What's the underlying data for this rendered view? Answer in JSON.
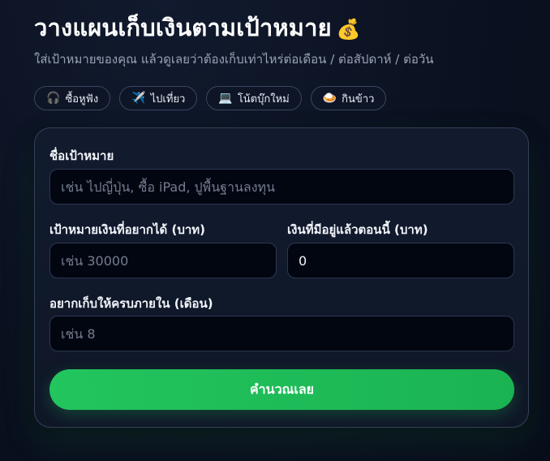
{
  "header": {
    "title": "วางแผนเก็บเงินตามเป้าหมาย",
    "title_emoji": "💰",
    "subtitle": "ใส่เป้าหมายของคุณ แล้วดูเลยว่าต้องเก็บเท่าไหร่ต่อเดือน / ต่อสัปดาห์ / ต่อวัน"
  },
  "presets": [
    {
      "label": "ซื้อหูฟัง",
      "icon": "🎧",
      "icon_name": "headphones-icon"
    },
    {
      "label": "ไปเที่ยว",
      "icon": "✈️",
      "icon_name": "airplane-icon"
    },
    {
      "label": "โน้ตบุ๊กใหม่",
      "icon": "💻",
      "icon_name": "laptop-icon"
    },
    {
      "label": "กินข้าว",
      "icon": "🍛",
      "icon_name": "rice-bowl-icon"
    }
  ],
  "form": {
    "goal_name": {
      "label": "ชื่อเป้าหมาย",
      "placeholder": "เช่น ไปญี่ปุ่น, ซื้อ iPad, ปูพื้นฐานลงทุน",
      "value": ""
    },
    "target_amount": {
      "label": "เป้าหมายเงินที่อยากได้ (บาท)",
      "placeholder": "เช่น 30000",
      "value": ""
    },
    "current_amount": {
      "label": "เงินที่มีอยู่แล้วตอนนี้ (บาท)",
      "placeholder": "",
      "value": "0"
    },
    "months": {
      "label": "อยากเก็บให้ครบภายใน (เดือน)",
      "placeholder": "เช่น 8",
      "value": ""
    },
    "submit_label": "คำนวณเลย"
  },
  "colors": {
    "background": "#0b1120",
    "card_background": "#121b2e",
    "input_background": "#020611",
    "accent": "#22c55e",
    "text_primary": "#ffffff",
    "text_secondary": "#9aa3b5"
  }
}
